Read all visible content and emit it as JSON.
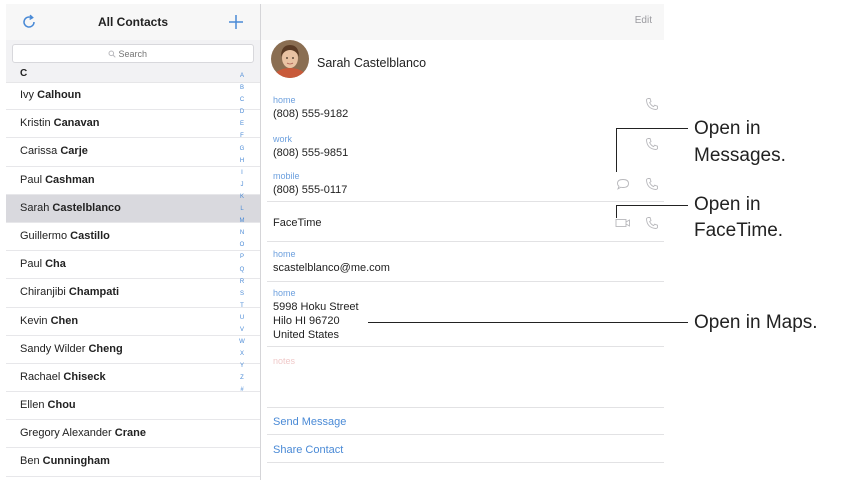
{
  "contacts_list": {
    "title": "All Contacts",
    "search_placeholder": "Search",
    "section_letter": "C",
    "rows": [
      {
        "first": "Ivy",
        "last": "Calhoun"
      },
      {
        "first": "Kristin",
        "last": "Canavan"
      },
      {
        "first": "Carissa",
        "last": "Carje"
      },
      {
        "first": "Paul",
        "last": "Cashman"
      },
      {
        "first": "Sarah",
        "last": "Castelblanco",
        "selected": true
      },
      {
        "first": "Guillermo",
        "last": "Castillo"
      },
      {
        "first": "Paul",
        "last": "Cha"
      },
      {
        "first": "Chiranjibi",
        "last": "Champati"
      },
      {
        "first": "Kevin",
        "last": "Chen"
      },
      {
        "first": "Sandy Wilder",
        "last": "Cheng"
      },
      {
        "first": "Rachael",
        "last": "Chiseck"
      },
      {
        "first": "Ellen",
        "last": "Chou"
      },
      {
        "first": "Gregory Alexander",
        "last": "Crane"
      },
      {
        "first": "Ben",
        "last": "Cunningham"
      }
    ],
    "index_letters": [
      "A",
      "B",
      "C",
      "D",
      "E",
      "F",
      "G",
      "H",
      "I",
      "J",
      "K",
      "L",
      "M",
      "N",
      "O",
      "P",
      "Q",
      "R",
      "S",
      "T",
      "U",
      "V",
      "W",
      "X",
      "Y",
      "Z",
      "#"
    ]
  },
  "detail": {
    "edit_label": "Edit",
    "name": "Sarah  Castelblanco",
    "phones": [
      {
        "label": "home",
        "value": "(808) 555-9182"
      },
      {
        "label": "work",
        "value": "(808) 555-9851"
      },
      {
        "label": "mobile",
        "value": "(808) 555-0117"
      }
    ],
    "facetime_label": "FaceTime",
    "email": {
      "label": "home",
      "value": "scastelblanco@me.com"
    },
    "address": {
      "label": "home",
      "line1": "5998 Hoku Street",
      "line2": "Hilo HI 96720",
      "line3": "United States"
    },
    "notes_label": "notes",
    "actions": [
      "Send Message",
      "Share Contact"
    ]
  },
  "callouts": {
    "messages_line1": "Open in",
    "messages_line2": "Messages.",
    "facetime_line1": "Open in",
    "facetime_line2": "FaceTime.",
    "maps": "Open in Maps."
  },
  "colors": {
    "accent": "#4a8ad6",
    "selected_row": "#d9d9de",
    "field_label": "#6da0de"
  }
}
